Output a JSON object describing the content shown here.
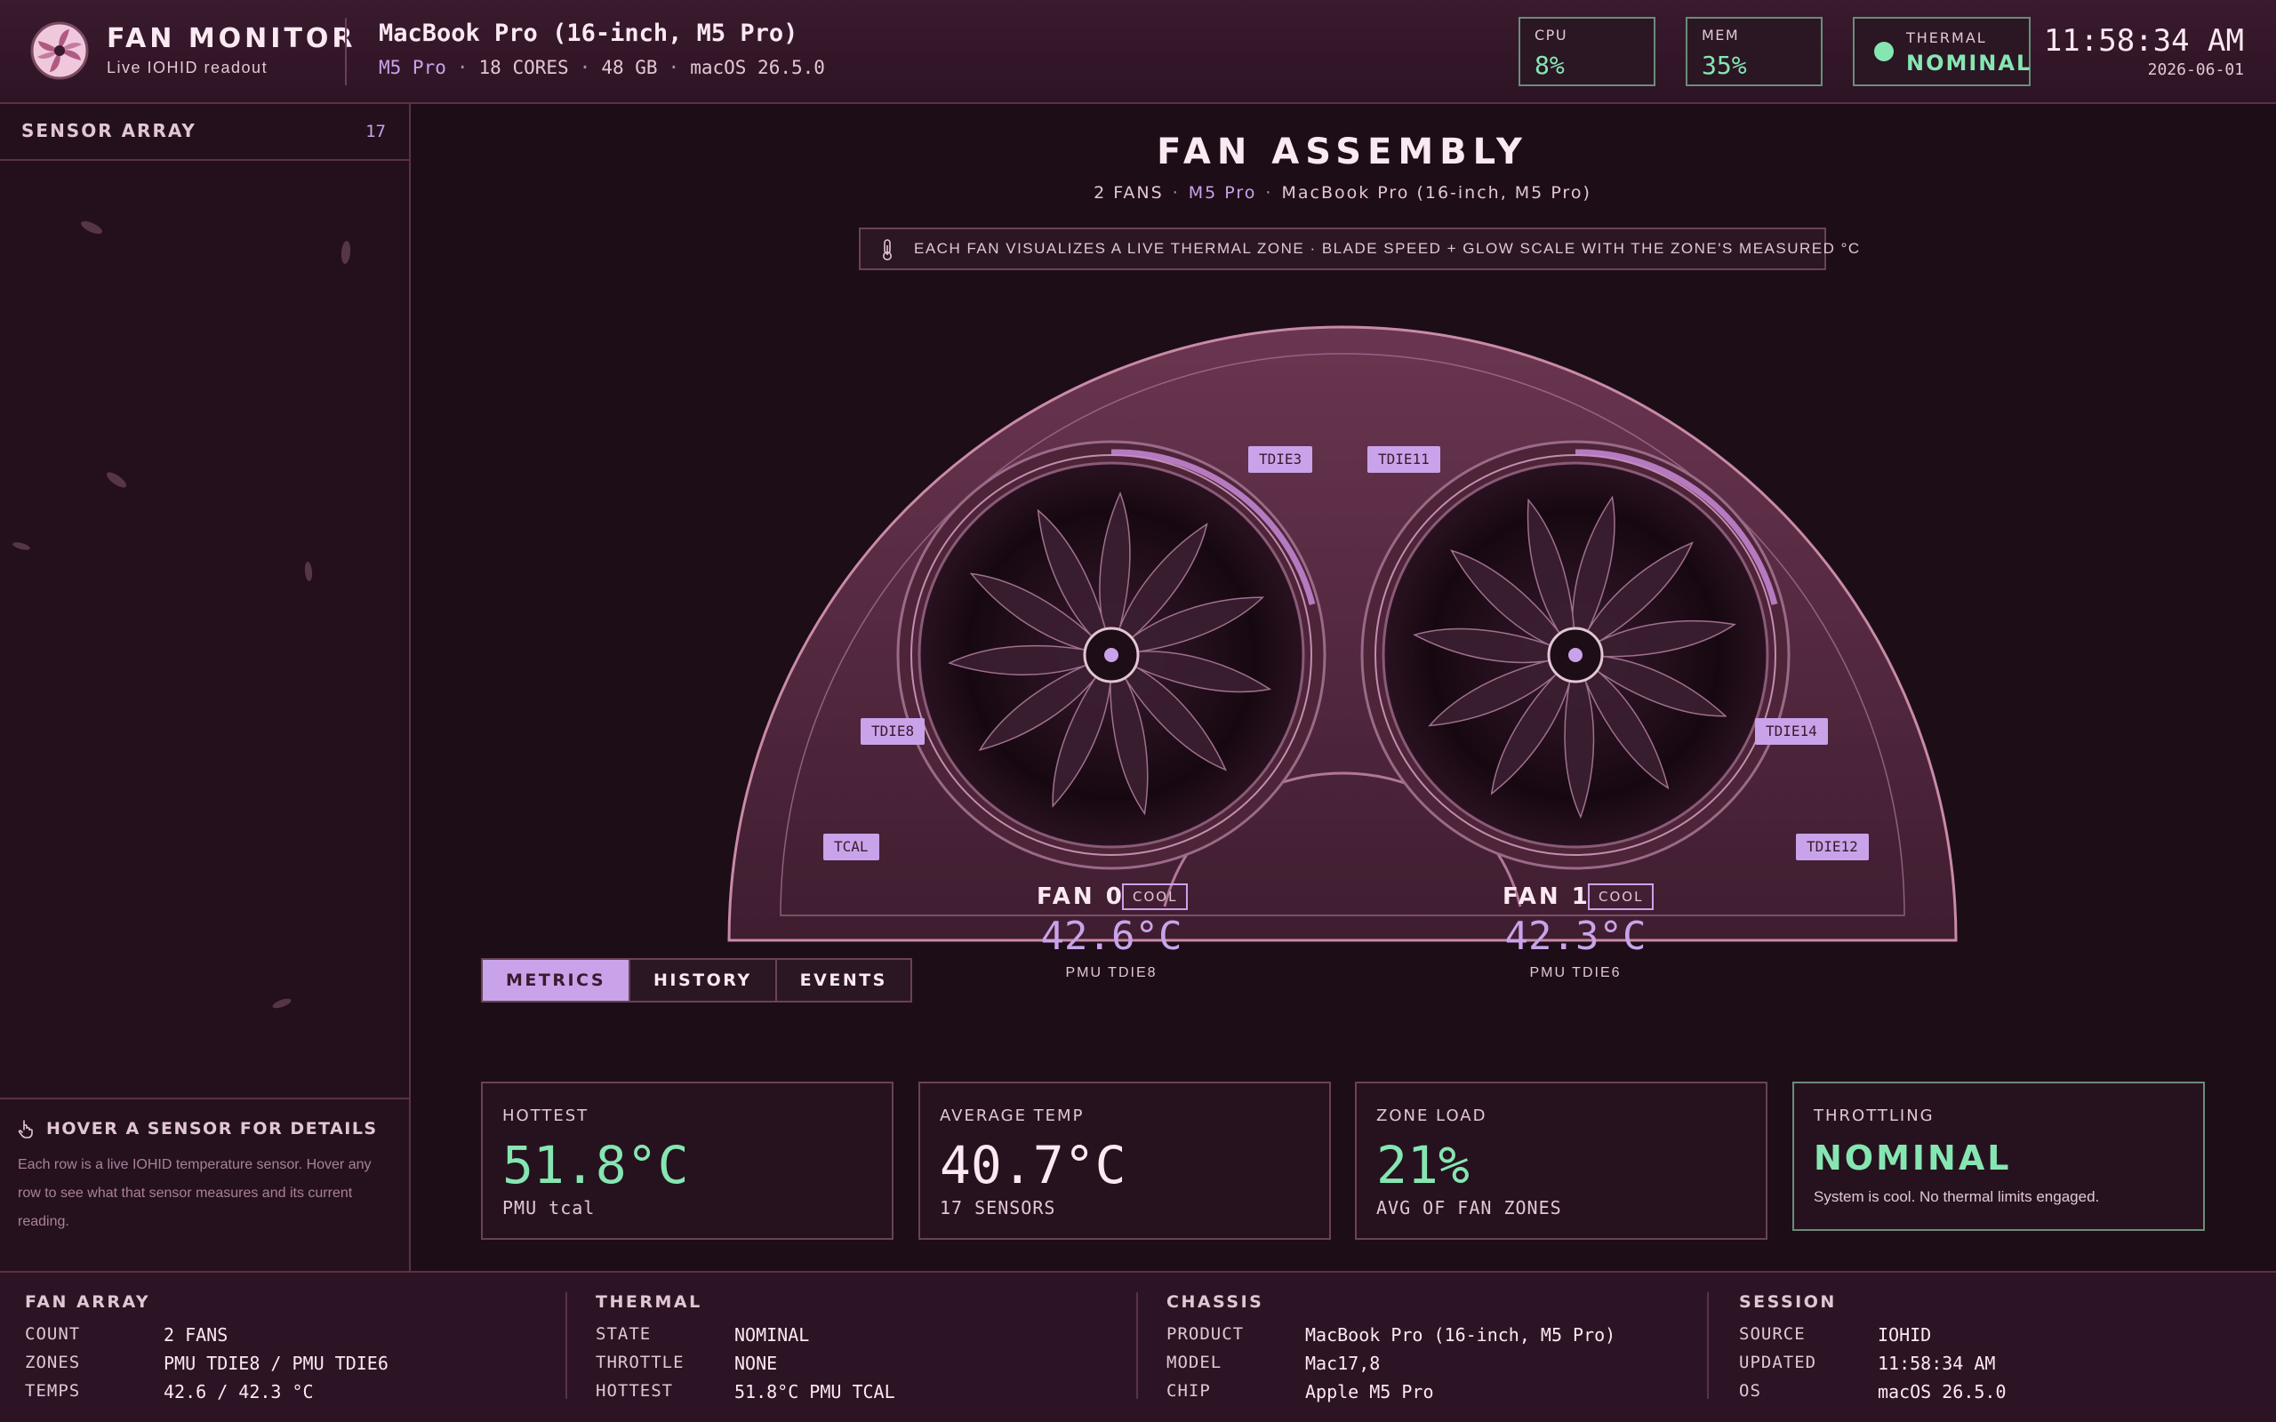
{
  "header": {
    "app_title": "FAN MONITOR",
    "app_subtitle": "Live IOHID readout",
    "device_name": "MacBook Pro (16-inch, M5 Pro)",
    "chip": "M5 Pro",
    "cores": "18 CORES",
    "memory": "48 GB",
    "os": "macOS 26.5.0",
    "cpu": {
      "label": "CPU",
      "value": "8%"
    },
    "mem": {
      "label": "MEM",
      "value": "35%"
    },
    "thermal": {
      "label": "THERMAL",
      "value": "NOMINAL"
    },
    "clock": "11:58:34 AM",
    "date": "2026-06-01"
  },
  "sidebar": {
    "title": "SENSOR ARRAY",
    "count": "17",
    "hint_title": "HOVER A SENSOR FOR DETAILS",
    "hint_text": "Each row is a live IOHID temperature sensor. Hover any row to see what that sensor measures and its current reading."
  },
  "main": {
    "title": "FAN ASSEMBLY",
    "sub_fans": "2 FANS",
    "sub_chip": "M5 Pro",
    "sub_model": "MacBook Pro (16-inch, M5 Pro)",
    "banner": "EACH FAN VISUALIZES A LIVE THERMAL ZONE · BLADE SPEED + GLOW SCALE WITH THE ZONE'S MEASURED °C",
    "sensors": {
      "tdie3": "TDIE3",
      "tdie11": "TDIE11",
      "tdie8": "TDIE8",
      "tdie14": "TDIE14",
      "tcal": "TCAL",
      "tdie12": "TDIE12"
    },
    "fans": [
      {
        "label": "FAN 0",
        "status": "COOL",
        "temp": "42.6°C",
        "zone": "PMU TDIE8"
      },
      {
        "label": "FAN 1",
        "status": "COOL",
        "temp": "42.3°C",
        "zone": "PMU TDIE6"
      }
    ],
    "tabs": [
      "METRICS",
      "HISTORY",
      "EVENTS"
    ]
  },
  "metrics": {
    "hottest": {
      "label": "HOTTEST",
      "value": "51.8°C",
      "sub": "PMU tcal"
    },
    "average": {
      "label": "AVERAGE TEMP",
      "value": "40.7°C",
      "sub": "17 SENSORS"
    },
    "zone_load": {
      "label": "ZONE LOAD",
      "value": "21%",
      "sub": "AVG OF FAN ZONES"
    },
    "throttling": {
      "label": "THROTTLING",
      "value": "NOMINAL",
      "sub": "System is cool. No thermal limits engaged."
    }
  },
  "footer": {
    "fan_array": {
      "title": "FAN ARRAY",
      "rows": [
        {
          "k": "COUNT",
          "v": "2 FANS"
        },
        {
          "k": "ZONES",
          "v": "PMU TDIE8 / PMU TDIE6"
        },
        {
          "k": "TEMPS",
          "v": "42.6 / 42.3 °C"
        }
      ]
    },
    "thermal": {
      "title": "THERMAL",
      "rows": [
        {
          "k": "STATE",
          "v": "NOMINAL"
        },
        {
          "k": "THROTTLE",
          "v": "NONE"
        },
        {
          "k": "HOTTEST",
          "v": "51.8°C PMU TCAL"
        }
      ]
    },
    "chassis": {
      "title": "CHASSIS",
      "rows": [
        {
          "k": "PRODUCT",
          "v": "MacBook Pro (16-inch, M5 Pro)"
        },
        {
          "k": "MODEL",
          "v": "Mac17,8"
        },
        {
          "k": "CHIP",
          "v": "Apple M5 Pro"
        }
      ]
    },
    "session": {
      "title": "SESSION",
      "rows": [
        {
          "k": "SOURCE",
          "v": "IOHID"
        },
        {
          "k": "UPDATED",
          "v": "11:58:34 AM"
        },
        {
          "k": "OS",
          "v": "macOS 26.5.0"
        }
      ]
    }
  },
  "colors": {
    "accent": "#c9a3ea",
    "good": "#86e6b2",
    "bg": "#1d0d17"
  }
}
